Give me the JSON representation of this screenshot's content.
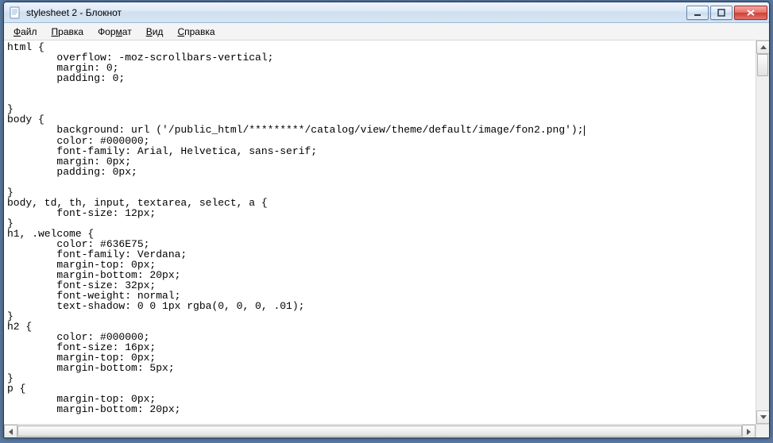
{
  "window": {
    "title": "stylesheet 2 - Блокнот"
  },
  "menu": {
    "file": {
      "label": "Файл",
      "hotkey_index": 0
    },
    "edit": {
      "label": "Правка",
      "hotkey_index": 0
    },
    "format": {
      "label": "Формат",
      "hotkey_index": 3
    },
    "view": {
      "label": "Вид",
      "hotkey_index": 0
    },
    "help": {
      "label": "Справка",
      "hotkey_index": 0
    }
  },
  "editor": {
    "caret_line": 8,
    "caret_after": "background: url ('/public_html/*********/catalog/view/theme/default/image/fon2.png');",
    "lines": [
      "html {",
      "        overflow: -moz-scrollbars-vertical;",
      "        margin: 0;",
      "        padding: 0;",
      "",
      "",
      "}",
      "body {",
      "        background: url ('/public_html/*********/catalog/view/theme/default/image/fon2.png');",
      "        color: #000000;",
      "        font-family: Arial, Helvetica, sans-serif;",
      "        margin: 0px;",
      "        padding: 0px;",
      "",
      "}",
      "body, td, th, input, textarea, select, a {",
      "        font-size: 12px;",
      "}",
      "h1, .welcome {",
      "        color: #636E75;",
      "        font-family: Verdana;",
      "        margin-top: 0px;",
      "        margin-bottom: 20px;",
      "        font-size: 32px;",
      "        font-weight: normal;",
      "        text-shadow: 0 0 1px rgba(0, 0, 0, .01);",
      "}",
      "h2 {",
      "        color: #000000;",
      "        font-size: 16px;",
      "        margin-top: 0px;",
      "        margin-bottom: 5px;",
      "}",
      "p {",
      "        margin-top: 0px;",
      "        margin-bottom: 20px;"
    ]
  }
}
